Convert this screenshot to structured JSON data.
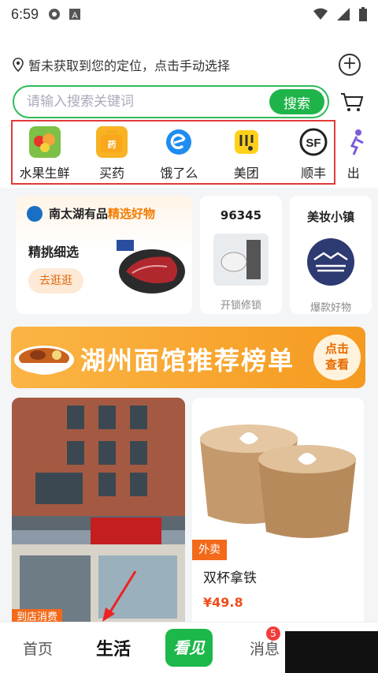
{
  "status": {
    "time": "6:59"
  },
  "header": {
    "location": "暂未获取到您的定位，点击手动选择",
    "search_placeholder": "请输入搜索关键词",
    "search_button": "搜索"
  },
  "quick_items": [
    {
      "label": "水果生鲜",
      "icon": "fruit-basket-icon"
    },
    {
      "label": "买药",
      "icon": "medicine-icon"
    },
    {
      "label": "饿了么",
      "icon": "eleme-icon"
    },
    {
      "label": "美团",
      "icon": "meituan-icon"
    },
    {
      "label": "顺丰",
      "icon": "sf-express-icon"
    },
    {
      "label": "出",
      "icon": "runner-icon"
    }
  ],
  "card_main": {
    "brand": "南太湖有品",
    "highlight": "精选好物",
    "subtitle": "精挑细选",
    "button": "去逛逛",
    "colors": {
      "accent": "#f47b00"
    }
  },
  "card_lock": {
    "title": "96345",
    "label": "开锁修锁"
  },
  "card_beauty": {
    "title": "美妆小镇",
    "label": "爆款好物"
  },
  "banner": {
    "text": "湖州面馆推荐榜单",
    "button_line1": "点击",
    "button_line2": "查看"
  },
  "feed": {
    "left_tag": "到店消费",
    "right_tag": "外卖",
    "right_title": "双杯拿铁",
    "right_price": "¥49.8"
  },
  "nav": {
    "home": "首页",
    "life": "生活",
    "center": "看见",
    "messages": "消息",
    "badge": "5"
  },
  "colors": {
    "primary_green": "#1fb44a",
    "orange": "#f26a1a",
    "red_outline": "#e23b3b"
  }
}
